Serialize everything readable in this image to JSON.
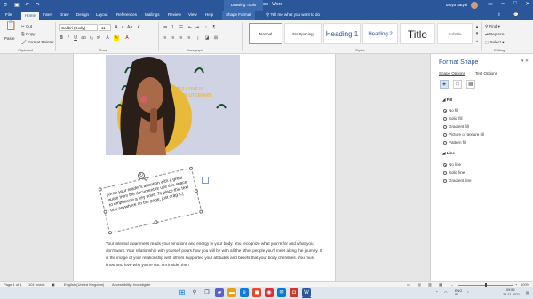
{
  "window": {
    "title": "test.docx - Word",
    "context_tab": "Drawing Tools",
    "user": "tanya patyal"
  },
  "colors": {
    "brand": "#2b579a",
    "accent_yellow": "#e9b93a"
  },
  "tabs": [
    "File",
    "Home",
    "Insert",
    "Draw",
    "Design",
    "Layout",
    "References",
    "Mailings",
    "Review",
    "View",
    "Help",
    "Shape Format"
  ],
  "tell_me": "Tell me what you want to do",
  "ribbon": {
    "clipboard": {
      "paste": "Paste",
      "cut": "Cut",
      "copy": "Copy",
      "format_painter": "Format Painter",
      "group": "Clipboard"
    },
    "font": {
      "name": "Calibri (Body)",
      "size": "11",
      "group": "Font"
    },
    "paragraph": {
      "group": "Paragraph"
    },
    "styles": {
      "items": [
        "Normal",
        "No Spacing",
        "Heading 1",
        "Heading 2",
        "Title",
        "Subtitle"
      ],
      "group": "Styles"
    },
    "editing": {
      "find": "Find",
      "replace": "Replace",
      "select": "Select",
      "group": "Editing"
    }
  },
  "document": {
    "image_text": [
      "SELF LOVE IS",
      "REVOLUTIONARY."
    ],
    "textbox": "[Grab your reader's attention with a great quote from the document or use this space to emphasize a key point. To place this text box anywhere on the page, just drag it.]",
    "paragraph": "Your internal awareness reads your emotions and energy in your body. You recognize what you're for and what you don't want. Your relationship with yourself pours how you will be with all the other people you'll meet along the journey. It is the image of your relationship with others supported your attitudes and beliefs that your body cherishes. You must know and love who you're not. I'm inside, then"
  },
  "pane": {
    "title": "Format Shape",
    "tabs": [
      "Shape Options",
      "Text Options"
    ],
    "fill_label": "Fill",
    "fill_options": [
      "No fill",
      "Solid fill",
      "Gradient fill",
      "Picture or texture fill",
      "Pattern fill"
    ],
    "fill_selected": 0,
    "line_label": "Line",
    "line_options": [
      "No line",
      "Solid line",
      "Gradient line"
    ],
    "line_selected": 0
  },
  "status": {
    "page": "Page 1 of 1",
    "words": "101 words",
    "language": "English (United Kingdom)",
    "accessibility": "Accessibility: Investigate",
    "zoom": "100%"
  },
  "taskbar": {
    "weather": "ENG IN",
    "time": "09:55",
    "date": "29-11-2021"
  }
}
